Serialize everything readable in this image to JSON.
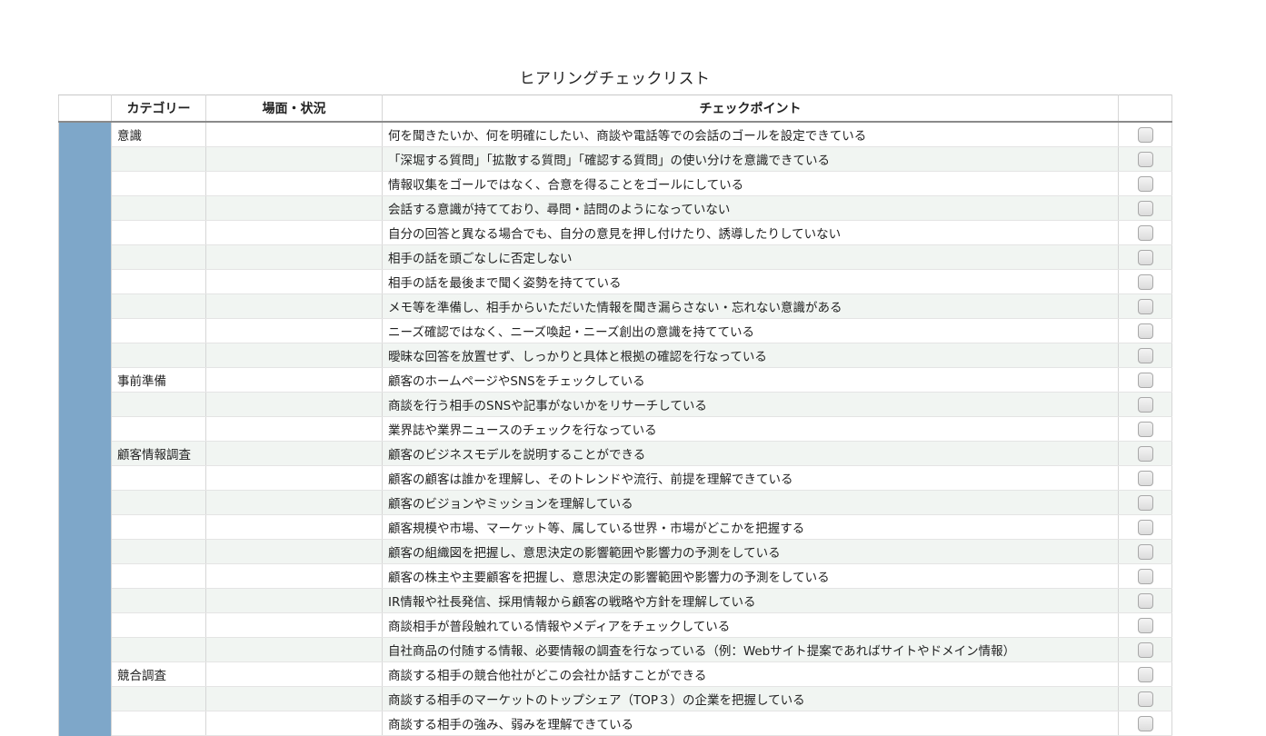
{
  "title": "ヒアリングチェックリスト",
  "columns": {
    "category": "カテゴリー",
    "scene": "場面・状況",
    "checkpoint": "チェックポイント",
    "check": ""
  },
  "colors": {
    "band": "#7ea7c9",
    "stripe": "#f1f5f2"
  },
  "rows": [
    {
      "category": "意識",
      "scene": "",
      "point": "何を聞きたいか、何を明確にしたい、商談や電話等での会話のゴールを設定できている",
      "checked": false
    },
    {
      "category": "",
      "scene": "",
      "point": "「深堀する質問」「拡散する質問」「確認する質問」の使い分けを意識できている",
      "checked": false
    },
    {
      "category": "",
      "scene": "",
      "point": "情報収集をゴールではなく、合意を得ることをゴールにしている",
      "checked": false
    },
    {
      "category": "",
      "scene": "",
      "point": "会話する意識が持てており、尋問・詰問のようになっていない",
      "checked": false
    },
    {
      "category": "",
      "scene": "",
      "point": "自分の回答と異なる場合でも、自分の意見を押し付けたり、誘導したりしていない",
      "checked": false
    },
    {
      "category": "",
      "scene": "",
      "point": "相手の話を頭ごなしに否定しない",
      "checked": false
    },
    {
      "category": "",
      "scene": "",
      "point": "相手の話を最後まで聞く姿勢を持てている",
      "checked": false
    },
    {
      "category": "",
      "scene": "",
      "point": "メモ等を準備し、相手からいただいた情報を聞き漏らさない・忘れない意識がある",
      "checked": false
    },
    {
      "category": "",
      "scene": "",
      "point": "ニーズ確認ではなく、ニーズ喚起・ニーズ創出の意識を持てている",
      "checked": false
    },
    {
      "category": "",
      "scene": "",
      "point": "曖昧な回答を放置せず、しっかりと具体と根拠の確認を行なっている",
      "checked": false
    },
    {
      "category": "事前準備",
      "scene": "",
      "point": "顧客のホームページやSNSをチェックしている",
      "checked": false
    },
    {
      "category": "",
      "scene": "",
      "point": "商談を行う相手のSNSや記事がないかをリサーチしている",
      "checked": false
    },
    {
      "category": "",
      "scene": "",
      "point": "業界誌や業界ニュースのチェックを行なっている",
      "checked": false
    },
    {
      "category": "顧客情報調査",
      "scene": "",
      "point": "顧客のビジネスモデルを説明することができる",
      "checked": false
    },
    {
      "category": "",
      "scene": "",
      "point": "顧客の顧客は誰かを理解し、そのトレンドや流行、前提を理解できている",
      "checked": false
    },
    {
      "category": "",
      "scene": "",
      "point": "顧客のビジョンやミッションを理解している",
      "checked": false
    },
    {
      "category": "",
      "scene": "",
      "point": "顧客規模や市場、マーケット等、属している世界・市場がどこかを把握する",
      "checked": false
    },
    {
      "category": "",
      "scene": "",
      "point": "顧客の組織図を把握し、意思決定の影響範囲や影響力の予測をしている",
      "checked": false
    },
    {
      "category": "",
      "scene": "",
      "point": "顧客の株主や主要顧客を把握し、意思決定の影響範囲や影響力の予測をしている",
      "checked": false
    },
    {
      "category": "",
      "scene": "",
      "point": "IR情報や社長発信、採用情報から顧客の戦略や方針を理解している",
      "checked": false
    },
    {
      "category": "",
      "scene": "",
      "point": "商談相手が普段触れている情報やメディアをチェックしている",
      "checked": false
    },
    {
      "category": "",
      "scene": "",
      "point": "自社商品の付随する情報、必要情報の調査を行なっている（例：Webサイト提案であればサイトやドメイン情報）",
      "checked": false
    },
    {
      "category": "競合調査",
      "scene": "",
      "point": "商談する相手の競合他社がどこの会社か話すことができる",
      "checked": false
    },
    {
      "category": "",
      "scene": "",
      "point": "商談する相手のマーケットのトップシェア（TOP３）の企業を把握している",
      "checked": false
    },
    {
      "category": "",
      "scene": "",
      "point": "商談する相手の強み、弱みを理解できている",
      "checked": false
    }
  ]
}
